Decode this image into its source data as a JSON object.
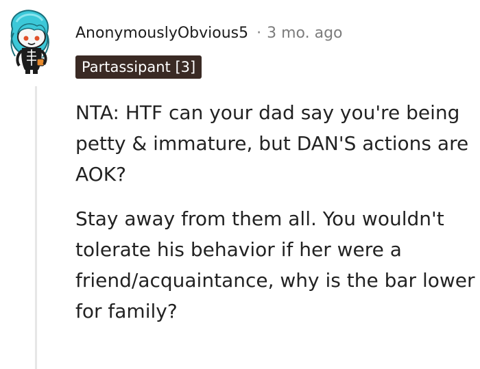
{
  "comment": {
    "author": "AnonymouslyObvious5",
    "separator": "·",
    "timestamp": "3 mo. ago",
    "flair": "Partassipant [3]",
    "paragraphs": [
      "NTA: HTF can your dad say you're being petty & immature, but DAN'S actions are AOK?",
      "Stay away from them all. You wouldn't tolerate his behavior if her were a friend/acquaintance, why is the bar lower for family?"
    ],
    "avatar_icon": "snoo-avatar-icon",
    "colors": {
      "flair_bg": "#3a2a24",
      "flair_text": "#ffffff",
      "meta_text": "#7c7c7c",
      "thread_line": "#e6e6e6",
      "avatar_hair": "#3cc8d8"
    }
  }
}
